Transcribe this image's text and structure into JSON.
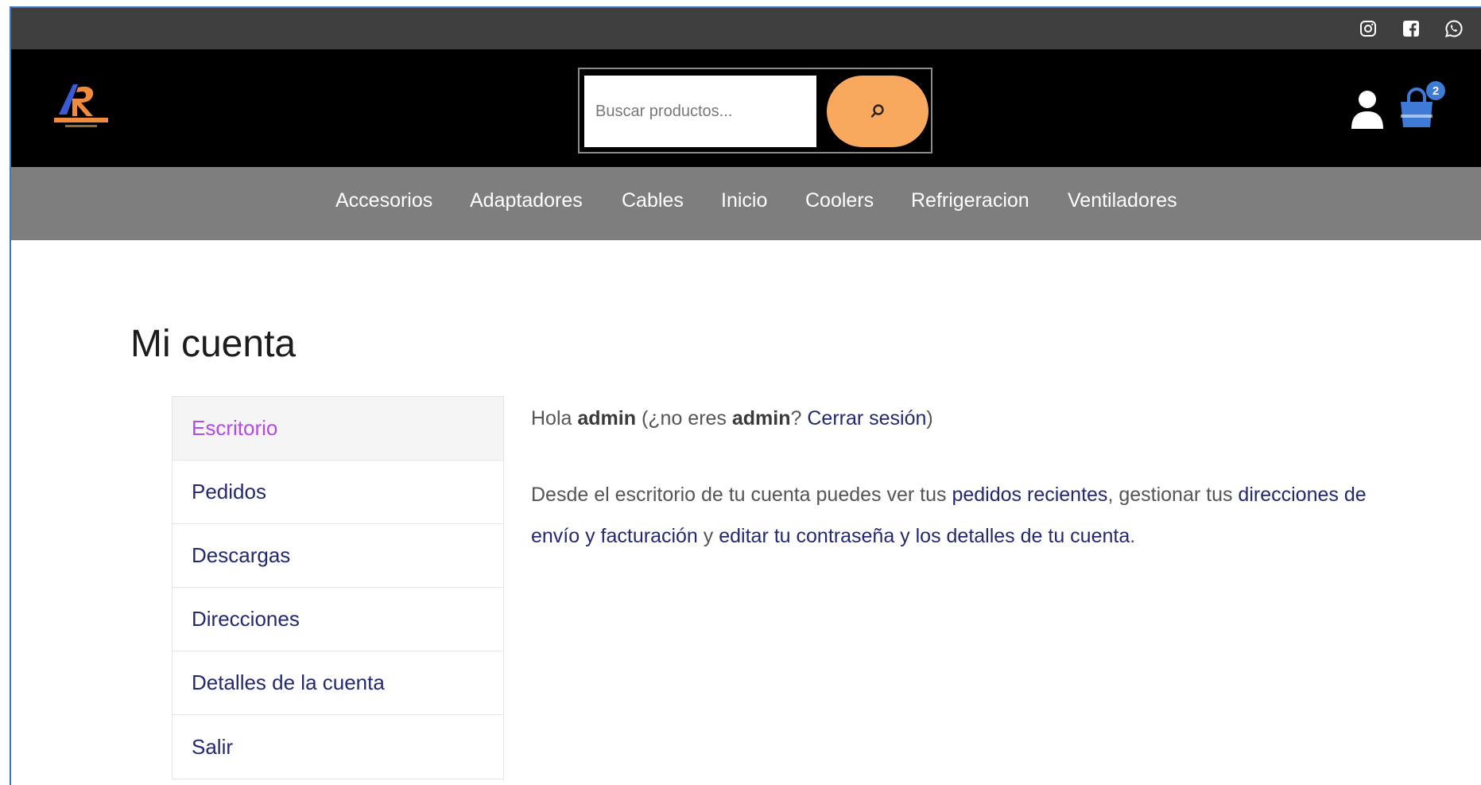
{
  "header": {
    "search": {
      "placeholder": "Buscar productos..."
    },
    "cart": {
      "count": "2"
    }
  },
  "social": [
    "instagram-icon",
    "facebook-icon",
    "whatsapp-icon"
  ],
  "nav": {
    "items": [
      "Accesorios",
      "Adaptadores",
      "Cables",
      "Inicio",
      "Coolers",
      "Refrigeracion",
      "Ventiladores"
    ]
  },
  "page": {
    "title": "Mi cuenta"
  },
  "account_nav": {
    "items": [
      {
        "label": "Escritorio",
        "active": true
      },
      {
        "label": "Pedidos"
      },
      {
        "label": "Descargas"
      },
      {
        "label": "Direcciones"
      },
      {
        "label": "Detalles de la cuenta"
      },
      {
        "label": "Salir"
      }
    ]
  },
  "content": {
    "greeting": {
      "prefix": "Hola ",
      "user": "admin",
      "mid": " (¿no eres ",
      "user2": "admin",
      "q": "? ",
      "logout": "Cerrar sesión",
      "suffix": ")"
    },
    "desc": {
      "p1": "Desde el escritorio de tu cuenta puedes ver tus ",
      "link1": "pedidos recientes",
      "p2": ", gestionar tus ",
      "link2": "direcciones de envío y facturación",
      "p3": " y ",
      "link3": "editar tu contraseña y los detalles de tu cuenta",
      "p4": "."
    }
  },
  "colors": {
    "topbar": "#3f3f3f",
    "header": "#000000",
    "nav": "#7e7e7e",
    "search_button": "#f9a95e",
    "cart_badge": "#3d7bd6",
    "link": "#232872",
    "active_nav": "#b24ae8"
  }
}
